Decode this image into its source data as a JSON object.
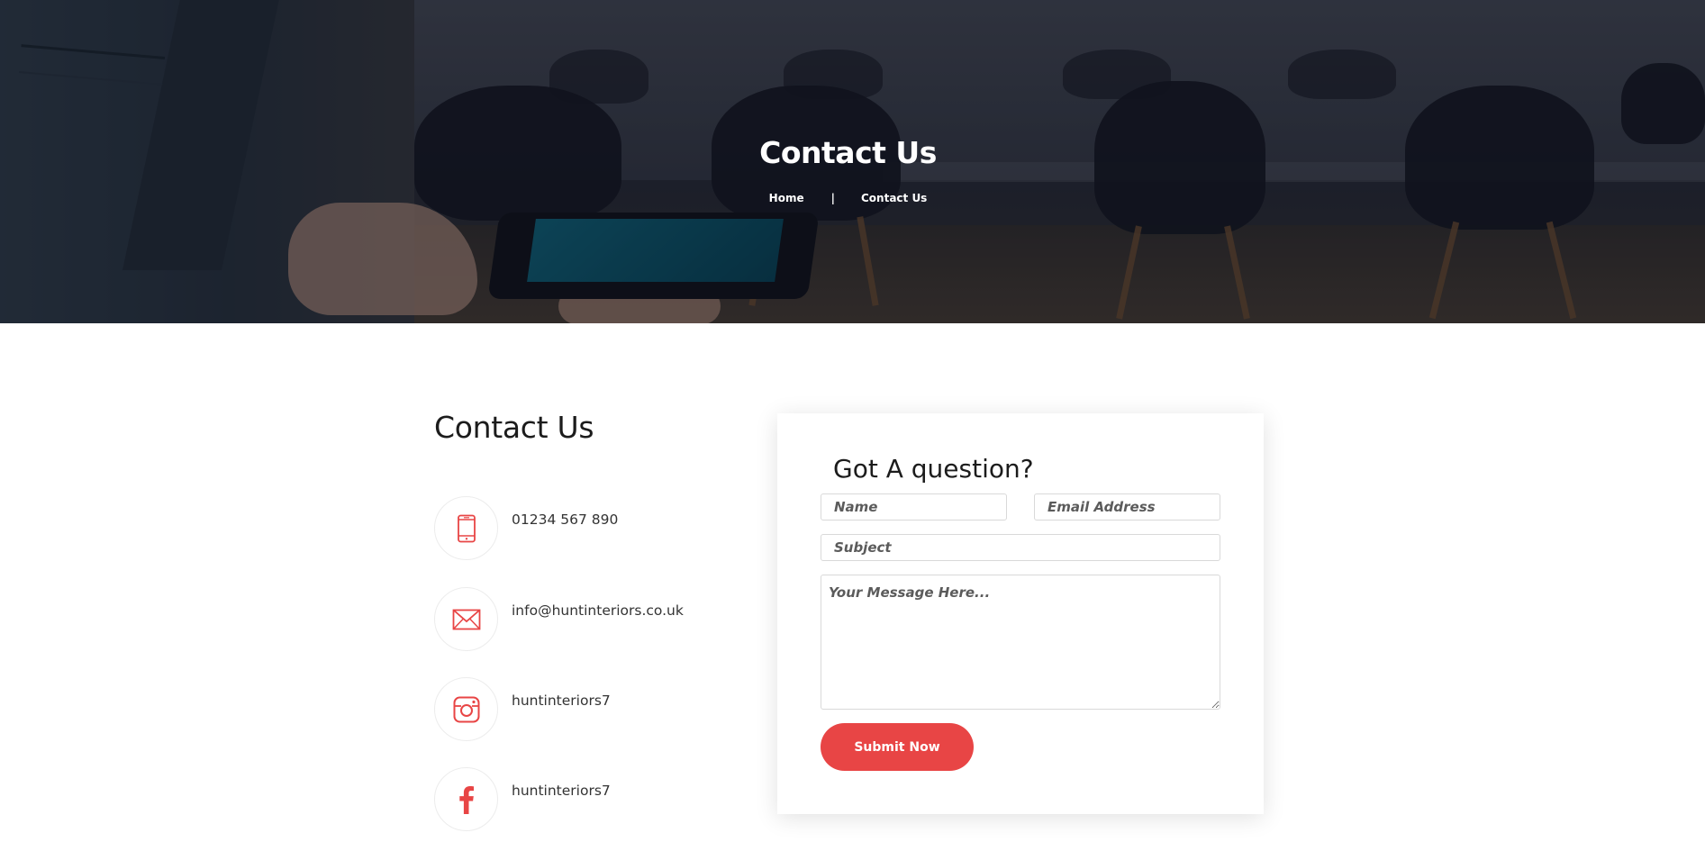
{
  "hero": {
    "title": "Contact Us",
    "breadcrumb": {
      "home": "Home",
      "separator": "|",
      "current": "Contact Us"
    }
  },
  "contact": {
    "heading": "Contact Us",
    "items": [
      {
        "icon": "phone-icon",
        "text": "01234 567 890"
      },
      {
        "icon": "mail-icon",
        "text": "info@huntinteriors.co.uk"
      },
      {
        "icon": "instagram-icon",
        "text": "huntinteriors7"
      },
      {
        "icon": "facebook-icon",
        "text": "huntinteriors7"
      }
    ]
  },
  "form": {
    "title": "Got A question?",
    "name_placeholder": "Name",
    "email_placeholder": "Email Address",
    "subject_placeholder": "Subject",
    "message_placeholder": "Your Message Here...",
    "submit_label": "Submit Now"
  },
  "colors": {
    "accent": "#e84545",
    "icon": "#e84545",
    "heading": "#1c1c1c",
    "text": "#333333"
  }
}
